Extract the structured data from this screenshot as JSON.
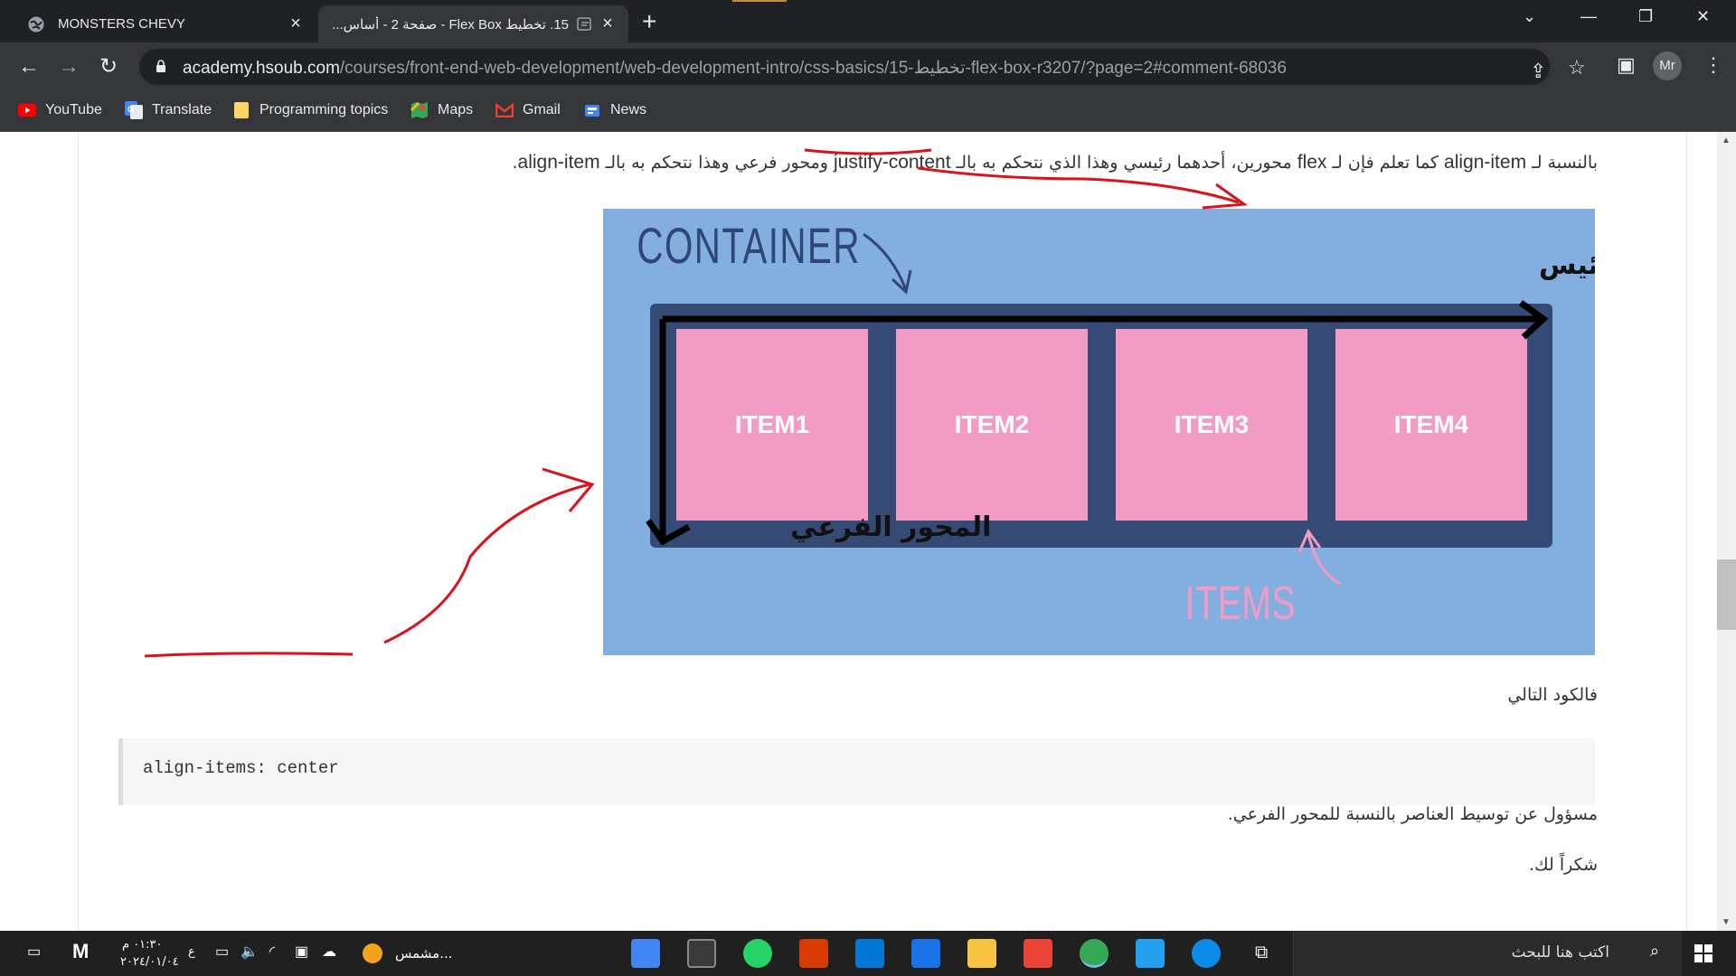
{
  "browser": {
    "tabs": [
      {
        "title": "MONSTERS CHEVY"
      },
      {
        "title": "15. تخطيط Flex Box - صفحة 2 - أساس..."
      }
    ],
    "url_host": "academy.hsoub.com",
    "url_path": "/courses/front-end-web-development/web-development-intro/css-basics/15-تخطيط-flex-box-r3207/?page=2#comment-68036",
    "profile_initials": "Mr",
    "bookmarks": [
      {
        "label": "YouTube",
        "icon": "youtube-icon"
      },
      {
        "label": "Translate",
        "icon": "translate-icon"
      },
      {
        "label": "Programming topics",
        "icon": "folder-icon"
      },
      {
        "label": "Maps",
        "icon": "maps-icon"
      },
      {
        "label": "Gmail",
        "icon": "gmail-icon"
      },
      {
        "label": "News",
        "icon": "news-icon"
      }
    ]
  },
  "content": {
    "para1_prefix": "بالنسبة لـ",
    "para1_align": "align-item",
    "para1_mid1": "كما تعلم فإن لـ",
    "para1_flex": "flex",
    "para1_mid2": "محورين، أحدهما رئيسي وهذا الذي نتحكم به بالـ",
    "para1_justify": "justify-content",
    "para1_mid3": "ومحور فرعي وهذا نتحكم به بالـ",
    "para1_align2": "align-item",
    "para1_end": ".",
    "diagram": {
      "container_label": "CONTAINER",
      "main_axis": "المحور الرئيس",
      "cross_axis": "المحور الفرعي",
      "items_label": "ITEMS",
      "items": [
        "ITEM1",
        "ITEM2",
        "ITEM3",
        "ITEM4"
      ]
    },
    "para2": "فالكود التالي",
    "code": "align-items: center",
    "para3": "مسؤول عن توسيط العناصر بالنسبة للمحور الفرعي.",
    "para4": "شكراً لك."
  },
  "taskbar": {
    "search_placeholder": "اكتب هنا للبحث",
    "time": "٠١:٣٠ م",
    "date": "٢٠٢٤/٠١/٠٤",
    "lang": "ع",
    "weather": "مشمس..."
  },
  "colors": {
    "diagram_bg": "#82aee0",
    "container_bg": "#354a75",
    "item_bg": "#f29bc5",
    "annotation_red": "#d9121b"
  }
}
